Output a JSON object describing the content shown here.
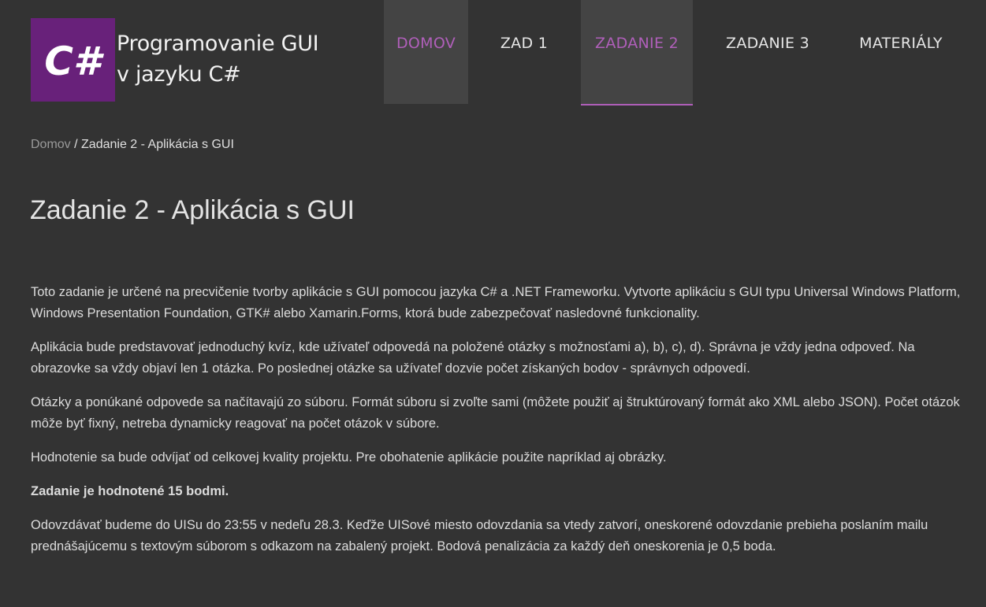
{
  "logo": {
    "text": "C#",
    "color": "#68217a"
  },
  "site_title": {
    "line1": "Programovanie GUI",
    "line2": "v jazyku C#"
  },
  "nav": {
    "items": [
      {
        "label": "DOMOV"
      },
      {
        "label": "ZAD 1"
      },
      {
        "label": "ZADANIE 2"
      },
      {
        "label": "ZADANIE 3"
      },
      {
        "label": "MATERIÁLY"
      }
    ],
    "accent_color": "#b05fba"
  },
  "breadcrumb": {
    "home": "Domov",
    "separator": " / ",
    "current": "Zadanie 2 - Aplikácia s GUI"
  },
  "page_title": "Zadanie 2 - Aplikácia s GUI",
  "content": {
    "p1": "Toto zadanie je určené na precvičenie tvorby aplikácie s GUI pomocou jazyka C# a .NET Frameworku. Vytvorte aplikáciu s GUI typu Universal Windows Platform, Windows Presentation Foundation, GTK# alebo Xamarin.Forms, ktorá bude zabezpečovať nasledovné funkcionality.",
    "p2": "Aplikácia bude predstavovať jednoduchý kvíz, kde užívateľ odpovedá na položené otázky s možnosťami a), b), c), d). Správna je vždy jedna odpoveď. Na obrazovke sa vždy objaví len 1 otázka. Po poslednej otázke sa užívateľ dozvie počet získaných bodov - správnych odpovedí.",
    "p3": "Otázky a ponúkané odpovede sa načítavajú zo súboru. Formát súboru si zvoľte sami (môžete použiť aj štruktúrovaný formát ako XML alebo JSON). Počet otázok môže byť fixný, netreba dynamicky reagovať na počet otázok v súbore.",
    "p4": "Hodnotenie sa bude odvíjať od celkovej kvality projektu. Pre obohatenie aplikácie použite napríklad aj obrázky.",
    "p5": "Zadanie je hodnotené 15 bodmi.",
    "p6": "Odovzdávať budeme do UISu do 23:55 v nedeľu 28.3. Keďže UISové miesto odovzdania sa vtedy zatvorí, oneskorené odovzdanie prebieha poslaním mailu prednášajúcemu s textovým súborom s odkazom na zabalený projekt. Bodová penalizácia za každý deň oneskorenia je 0,5 boda."
  }
}
